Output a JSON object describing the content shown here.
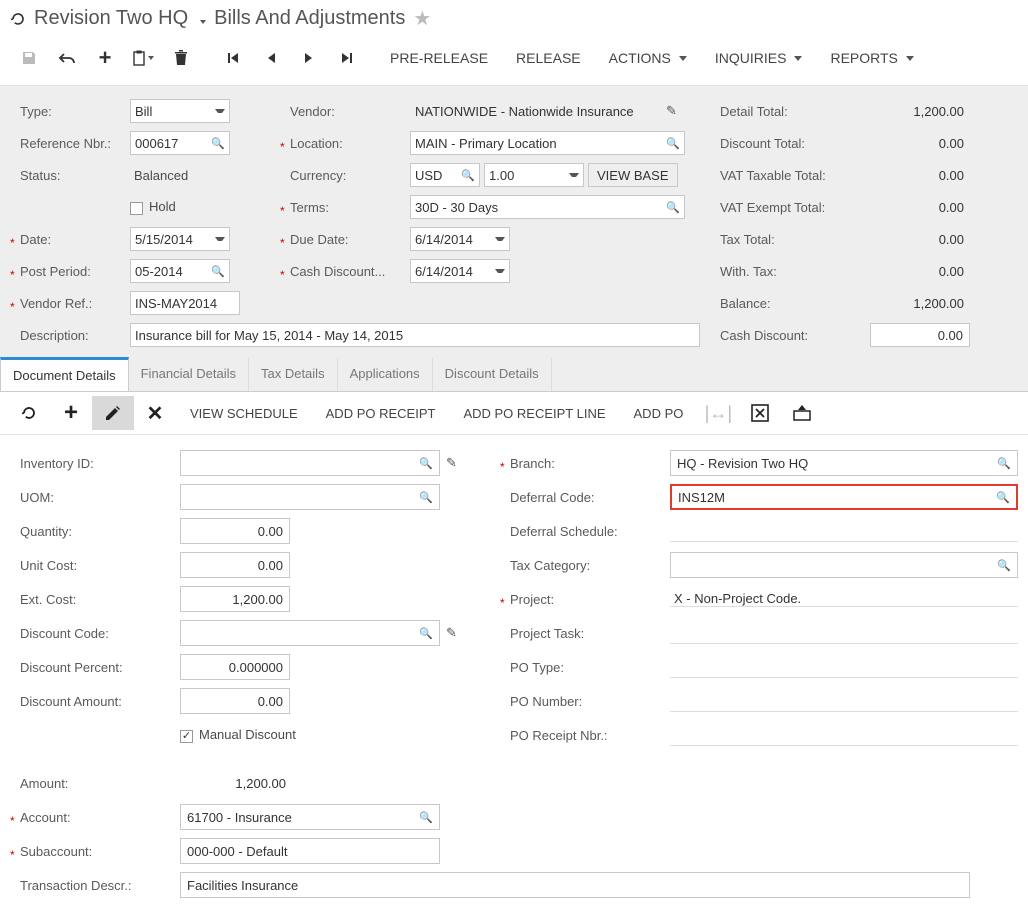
{
  "title": {
    "company": "Revision Two HQ",
    "page": "Bills And Adjustments"
  },
  "toolbar": {
    "prerelease": "PRE-RELEASE",
    "release": "RELEASE",
    "actions": "ACTIONS",
    "inquiries": "INQUIRIES",
    "reports": "REPORTS"
  },
  "header": {
    "type_lbl": "Type:",
    "type_val": "Bill",
    "ref_lbl": "Reference Nbr.:",
    "ref_val": "000617",
    "status_lbl": "Status:",
    "status_val": "Balanced",
    "hold_lbl": "Hold",
    "date_lbl": "Date:",
    "date_val": "5/15/2014",
    "post_lbl": "Post Period:",
    "post_val": "05-2014",
    "vendref_lbl": "Vendor Ref.:",
    "vendref_val": "INS-MAY2014",
    "desc_lbl": "Description:",
    "desc_val": "Insurance bill for May 15, 2014 - May 14, 2015",
    "vendor_lbl": "Vendor:",
    "vendor_val": "NATIONWIDE - Nationwide Insurance",
    "location_lbl": "Location:",
    "location_val": "MAIN - Primary Location",
    "currency_lbl": "Currency:",
    "currency_val": "USD",
    "currency_rate": "1.00",
    "viewbase": "VIEW BASE",
    "terms_lbl": "Terms:",
    "terms_val": "30D - 30 Days",
    "due_lbl": "Due Date:",
    "due_val": "6/14/2014",
    "cashdisc_lbl": "Cash Discount...",
    "cashdisc_val": "6/14/2014"
  },
  "totals": {
    "detail_lbl": "Detail Total:",
    "detail_val": "1,200.00",
    "discount_lbl": "Discount Total:",
    "discount_val": "0.00",
    "vattax_lbl": "VAT Taxable Total:",
    "vattax_val": "0.00",
    "vatex_lbl": "VAT Exempt Total:",
    "vatex_val": "0.00",
    "tax_lbl": "Tax Total:",
    "tax_val": "0.00",
    "with_lbl": "With. Tax:",
    "with_val": "0.00",
    "balance_lbl": "Balance:",
    "balance_val": "1,200.00",
    "cashd_lbl": "Cash Discount:",
    "cashd_val": "0.00"
  },
  "tabs": {
    "doc": "Document Details",
    "fin": "Financial Details",
    "tax": "Tax Details",
    "app": "Applications",
    "disc": "Discount Details"
  },
  "gridbar": {
    "viewschedule": "VIEW SCHEDULE",
    "addporeceipt": "ADD PO RECEIPT",
    "addporeceiptline": "ADD PO RECEIPT LINE",
    "addpo": "ADD PO"
  },
  "detail": {
    "inventory_lbl": "Inventory ID:",
    "inventory_val": "",
    "uom_lbl": "UOM:",
    "uom_val": "",
    "qty_lbl": "Quantity:",
    "qty_val": "0.00",
    "unitcost_lbl": "Unit Cost:",
    "unitcost_val": "0.00",
    "extcost_lbl": "Ext. Cost:",
    "extcost_val": "1,200.00",
    "disccode_lbl": "Discount Code:",
    "disccode_val": "",
    "discpct_lbl": "Discount Percent:",
    "discpct_val": "0.000000",
    "discamt_lbl": "Discount Amount:",
    "discamt_val": "0.00",
    "manual_lbl": "Manual Discount",
    "amount_lbl": "Amount:",
    "amount_val": "1,200.00",
    "account_lbl": "Account:",
    "account_val": "61700 - Insurance",
    "subacct_lbl": "Subaccount:",
    "subacct_val": "000-000 - Default",
    "txdesc_lbl": "Transaction Descr.:",
    "txdesc_val": "Facilities Insurance",
    "branch_lbl": "Branch:",
    "branch_val": "HQ - Revision Two HQ",
    "defcode_lbl": "Deferral Code:",
    "defcode_val": "INS12M",
    "defsched_lbl": "Deferral Schedule:",
    "taxcat_lbl": "Tax Category:",
    "taxcat_val": "",
    "project_lbl": "Project:",
    "project_val": "X - Non-Project Code.",
    "ptask_lbl": "Project Task:",
    "potype_lbl": "PO Type:",
    "ponum_lbl": "PO Number:",
    "porcpt_lbl": "PO Receipt Nbr.:"
  }
}
